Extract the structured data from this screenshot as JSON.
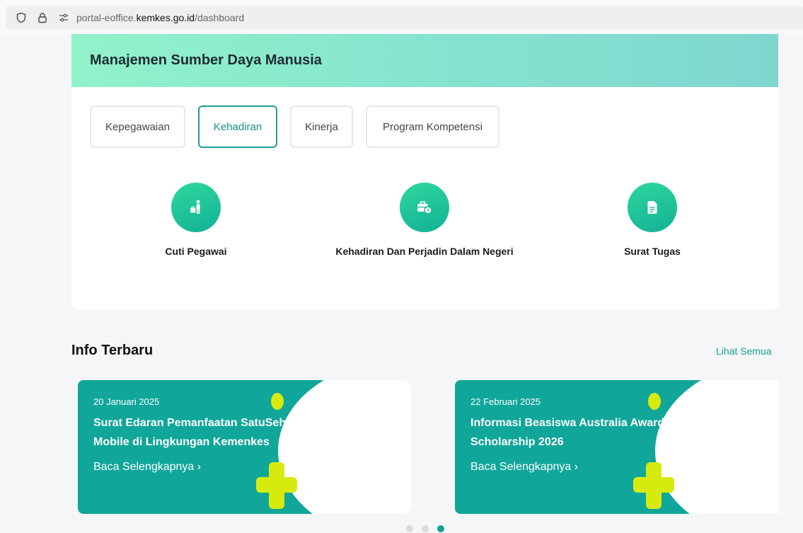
{
  "browser": {
    "url_prefix": "portal-eoffice.",
    "url_domain": "kemkes.go.id",
    "url_path": "/dashboard"
  },
  "module": {
    "title": "Manajemen Sumber Daya Manusia",
    "tabs": [
      {
        "label": "Kepegawaian",
        "active": false
      },
      {
        "label": "Kehadiran",
        "active": true
      },
      {
        "label": "Kinerja",
        "active": false
      },
      {
        "label": "Program Kompetensi",
        "active": false
      }
    ],
    "items": [
      {
        "label": "Cuti Pegawai",
        "icon": "person-leave-icon"
      },
      {
        "label": "Kehadiran Dan Perjadin Dalam Negeri",
        "icon": "briefcase-clock-icon"
      },
      {
        "label": "Surat Tugas",
        "icon": "document-icon"
      }
    ]
  },
  "info": {
    "title": "Info Terbaru",
    "see_all": "Lihat Semua",
    "cards": [
      {
        "date": "20 Januari 2025",
        "headline": "Surat Edaran Pemanfaatan SatuSehat Mobile di Lingkungan Kemenkes",
        "link": "Baca Selengkapnya"
      },
      {
        "date": "22 Februari 2025",
        "headline": "Informasi Beasiswa Australia Awards Scholarship 2026",
        "link": "Baca Selengkapnya"
      }
    ],
    "carousel": {
      "pages": 3,
      "active_page": 3
    }
  },
  "colors": {
    "accent": "#10a69a",
    "header_gradient_start": "#92f2ca",
    "header_gradient_end": "#7fd6cf",
    "decoration_yellow": "#d7ea0e"
  }
}
